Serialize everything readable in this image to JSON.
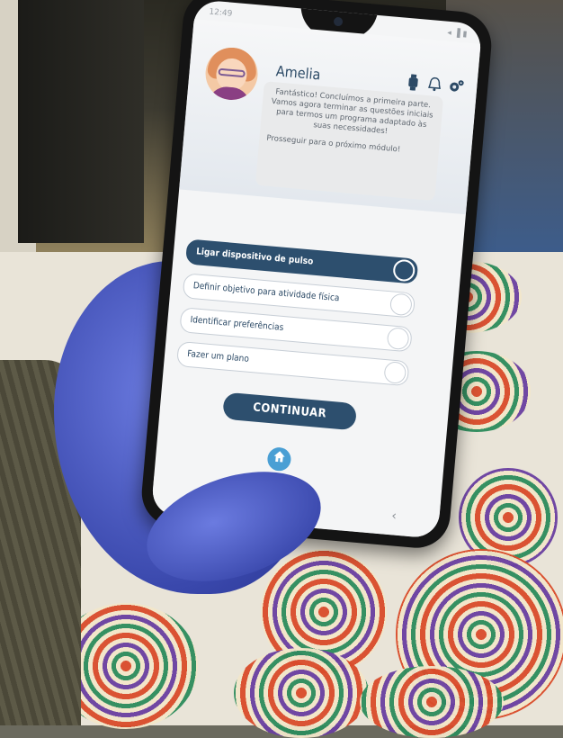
{
  "status_bar": {
    "time": "12:49",
    "indicators": "● ▸",
    "right_indicators": "◂ ▐ ▮"
  },
  "profile": {
    "name": "Amelia"
  },
  "message": {
    "line1": "Fantástico! Concluímos a primeira parte. Vamos agora terminar as questões iniciais para termos um programa adaptado às suas necessidades!",
    "line2": "Prosseguir para o próximo módulo!"
  },
  "steps": [
    {
      "label": "Ligar dispositivo de pulso",
      "active": true
    },
    {
      "label": "Definir objetivo para atividade física",
      "active": false
    },
    {
      "label": "Identificar preferências",
      "active": false
    },
    {
      "label": "Fazer um plano",
      "active": false
    }
  ],
  "continue_label": "CONTINUAR",
  "icons": {
    "header": [
      "smartwatch-icon",
      "bell-icon",
      "gear-icon"
    ],
    "home": "home-icon"
  },
  "colors": {
    "primary": "#2d4f6e",
    "home_button": "#4a9fd4"
  },
  "nav": {
    "recent": "|||",
    "home": "◯",
    "back": "‹"
  }
}
